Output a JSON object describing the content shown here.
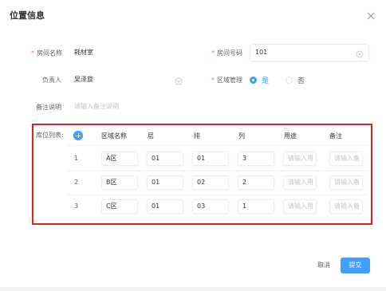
{
  "dialog": {
    "title": "位置信息"
  },
  "form": {
    "room_name": {
      "label": "房间名称",
      "value": "耗材室"
    },
    "room_number": {
      "label": "房间号码",
      "value": "101"
    },
    "owner": {
      "label": "负责人",
      "value": "吴泽旋"
    },
    "area_manage": {
      "label": "区域管理",
      "options": [
        "是",
        "否"
      ],
      "selected": "是"
    },
    "remark": {
      "label": "备注说明",
      "placeholder": "请输入备注说明"
    }
  },
  "storage_table": {
    "label": "库位列表:",
    "headers": [
      "区域名称",
      "层",
      "排",
      "列",
      "用途",
      "备注"
    ],
    "rows": [
      {
        "index": "1",
        "area": "A区",
        "layer": "01",
        "row": "01",
        "col": "3",
        "usage_placeholder": "请输入用",
        "note_placeholder": "请输入备"
      },
      {
        "index": "2",
        "area": "B区",
        "layer": "01",
        "row": "02",
        "col": "2",
        "usage_placeholder": "请输入用",
        "note_placeholder": "请输入备"
      },
      {
        "index": "3",
        "area": "C区",
        "layer": "01",
        "row": "03",
        "col": "1",
        "usage_placeholder": "请输入用",
        "note_placeholder": "请输入备"
      }
    ]
  },
  "footer": {
    "cancel_label": "取消",
    "submit_label": "提交"
  },
  "colors": {
    "primary": "#409eff",
    "required": "#f56c6c",
    "highlight_border": "#e02020"
  }
}
